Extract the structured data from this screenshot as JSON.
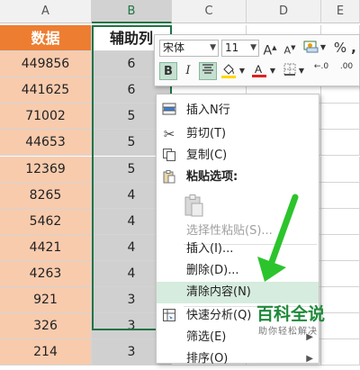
{
  "columns": [
    "A",
    "B",
    "C",
    "D",
    "E"
  ],
  "header_row": {
    "a": "数据",
    "b": "辅助列"
  },
  "rows": [
    {
      "a": "449856",
      "b": "6"
    },
    {
      "a": "441625",
      "b": "6"
    },
    {
      "a": "71002",
      "b": "5"
    },
    {
      "a": "44653",
      "b": "5"
    },
    {
      "a": "12369",
      "b": "5"
    },
    {
      "a": "8265",
      "b": "4"
    },
    {
      "a": "5462",
      "b": "4"
    },
    {
      "a": "4421",
      "b": "4"
    },
    {
      "a": "4263",
      "b": "4"
    },
    {
      "a": "921",
      "b": "3"
    },
    {
      "a": "326",
      "b": "3"
    },
    {
      "a": "214",
      "b": "3"
    }
  ],
  "mini_toolbar": {
    "font_name": "宋体",
    "font_size": "11",
    "increase_font": "A",
    "decrease_font": "A",
    "bold": "B",
    "italic": "I",
    "percent": "%",
    "comma": ",",
    "increase_decimal": "←.0",
    "decrease_decimal": ".00"
  },
  "context_menu": {
    "insert_n_rows": "插入N行",
    "cut": "剪切(T)",
    "copy": "复制(C)",
    "paste_options": "粘贴选项:",
    "paste_special": "选择性粘贴(S)...",
    "insert": "插入(I)...",
    "delete": "删除(D)...",
    "clear_contents": "清除内容(N)",
    "quick_analysis": "快速分析(Q)",
    "filter": "筛选(E)",
    "sort": "排序(O)"
  },
  "watermark": {
    "title": "百科全说",
    "subtitle": "助你轻松解决"
  },
  "colors": {
    "header_orange": "#ed7d31",
    "cell_peach": "#f8cbad",
    "selection_green": "#217346",
    "hover_green": "#d6ecde",
    "arrow_green": "#2cc42c"
  }
}
